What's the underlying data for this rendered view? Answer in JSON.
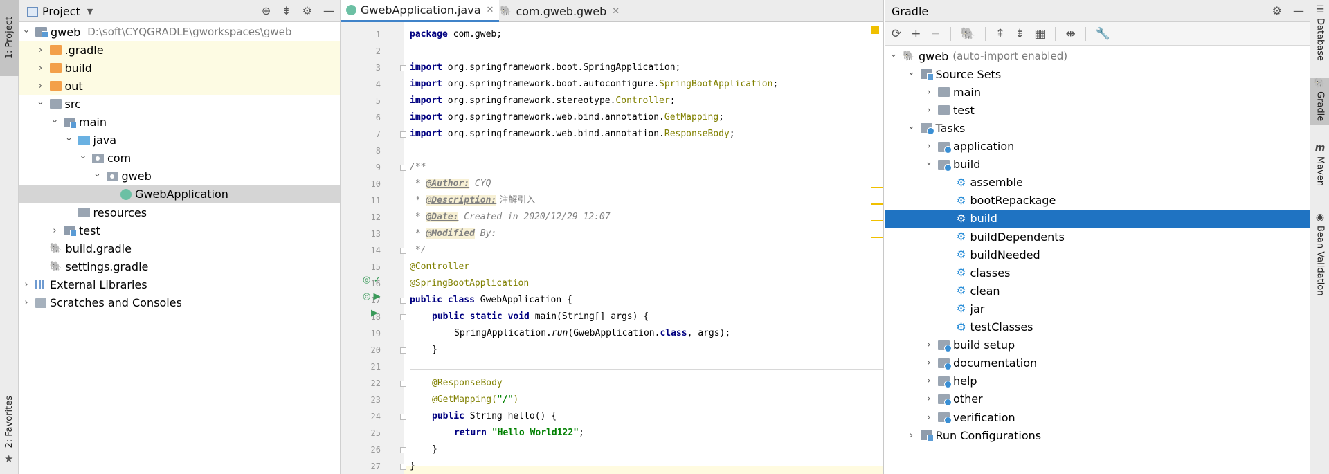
{
  "left_strip": {
    "project_tab": "1: Project",
    "favorites_tab": "2: Favorites"
  },
  "project": {
    "title": "Project",
    "tree": [
      {
        "label": "gweb",
        "path": "D:\\soft\\CYQGRADLE\\gworkspaces\\gweb",
        "icon": "folder-module",
        "depth": 0,
        "arrow": "down"
      },
      {
        "label": ".gradle",
        "icon": "folder-orange",
        "depth": 1,
        "arrow": "right",
        "highlight": "yellow"
      },
      {
        "label": "build",
        "icon": "folder-orange",
        "depth": 1,
        "arrow": "right",
        "highlight": "yellow"
      },
      {
        "label": "out",
        "icon": "folder-orange",
        "depth": 1,
        "arrow": "right",
        "highlight": "yellow"
      },
      {
        "label": "src",
        "icon": "folder-gray",
        "depth": 1,
        "arrow": "down"
      },
      {
        "label": "main",
        "icon": "folder-module",
        "depth": 2,
        "arrow": "down"
      },
      {
        "label": "java",
        "icon": "folder-blue",
        "depth": 3,
        "arrow": "down"
      },
      {
        "label": "com",
        "icon": "pkg",
        "depth": 4,
        "arrow": "down"
      },
      {
        "label": "gweb",
        "icon": "pkg",
        "depth": 5,
        "arrow": "down"
      },
      {
        "label": "GwebApplication",
        "icon": "spring",
        "depth": 6,
        "arrow": "",
        "highlight": "selected"
      },
      {
        "label": "resources",
        "icon": "folder-gray",
        "depth": 3,
        "arrow": ""
      },
      {
        "label": "test",
        "icon": "folder-module",
        "depth": 2,
        "arrow": "right"
      },
      {
        "label": "build.gradle",
        "icon": "elephant",
        "depth": 1,
        "arrow": ""
      },
      {
        "label": "settings.gradle",
        "icon": "elephant",
        "depth": 1,
        "arrow": ""
      },
      {
        "label": "External Libraries",
        "icon": "libs",
        "depth": 0,
        "arrow": "right"
      },
      {
        "label": "Scratches and Consoles",
        "icon": "scratch",
        "depth": 0,
        "arrow": "right"
      }
    ]
  },
  "editor": {
    "tabs": [
      {
        "label": "GwebApplication.java",
        "active": true
      },
      {
        "label": "com.gweb.gweb",
        "active": false
      }
    ],
    "lines": [
      "1",
      "2",
      "3",
      "4",
      "5",
      "6",
      "7",
      "8",
      "9",
      "10",
      "11",
      "12",
      "13",
      "14",
      "15",
      "16",
      "17",
      "18",
      "19",
      "20",
      "21",
      "22",
      "23",
      "24",
      "25",
      "26",
      "27"
    ],
    "code": {
      "l1_kw": "package",
      "l1_rest": " com.gweb;",
      "imp": "import",
      "l3": " org.springframework.boot.SpringApplication;",
      "l4a": " org.springframework.boot.autoconfigure.",
      "l4b": "SpringBootApplication",
      "l4c": ";",
      "l5a": " org.springframework.stereotype.",
      "l5b": "Controller",
      "l5c": ";",
      "l6a": " org.springframework.web.bind.annotation.",
      "l6b": "GetMapping",
      "l6c": ";",
      "l7a": " org.springframework.web.bind.annotation.",
      "l7b": "ResponseBody",
      "l7c": ";",
      "l9": "/**",
      "star": " * ",
      "l10_tag": "@Author:",
      "l10_val": " CYQ",
      "l11_tag": "@Description:",
      "l11_val": " 注解引入",
      "l12_tag": "@Date:",
      "l12_val": " Created in 2020/12/29 12:07",
      "l13_tag": "@Modified",
      "l13_val": " By:",
      "l14": " */",
      "l15": "@Controller",
      "l16": "@SpringBootApplication",
      "l17_kw": "public class",
      "l17_rest": " GwebApplication {",
      "l18_kw": "public static void",
      "l18_rest": " main(String[] args) {",
      "l19_a": "SpringApplication.",
      "l19_b": "run",
      "l19_c": "(GwebApplication.",
      "l19_d": "class",
      "l19_e": ", args);",
      "l20": "}",
      "l22": "@ResponseBody",
      "l23_a": "@GetMapping(",
      "l23_b": "\"/\"",
      "l23_c": ")",
      "l24_kw": "public",
      "l24_rest": " String hello() {",
      "l25_kw": "return",
      "l25_str": "\"Hello World122\"",
      "l25_rest": ";",
      "l26": "}",
      "l27": "}"
    }
  },
  "gradle": {
    "title": "Gradle",
    "tree": [
      {
        "label": "gweb",
        "suffix": "(auto-import enabled)",
        "icon": "elephant",
        "depth": 0,
        "arrow": "down"
      },
      {
        "label": "Source Sets",
        "icon": "folder-module",
        "depth": 1,
        "arrow": "down"
      },
      {
        "label": "main",
        "icon": "folder-gray",
        "depth": 2,
        "arrow": "right"
      },
      {
        "label": "test",
        "icon": "folder-gray",
        "depth": 2,
        "arrow": "right"
      },
      {
        "label": "Tasks",
        "icon": "taskfolder",
        "depth": 1,
        "arrow": "down"
      },
      {
        "label": "application",
        "icon": "taskfolder",
        "depth": 2,
        "arrow": "right"
      },
      {
        "label": "build",
        "icon": "taskfolder",
        "depth": 2,
        "arrow": "down"
      },
      {
        "label": "assemble",
        "icon": "gear",
        "depth": 3,
        "arrow": ""
      },
      {
        "label": "bootRepackage",
        "icon": "gear",
        "depth": 3,
        "arrow": ""
      },
      {
        "label": "build",
        "icon": "gear",
        "depth": 3,
        "arrow": "",
        "highlight": "blue"
      },
      {
        "label": "buildDependents",
        "icon": "gear",
        "depth": 3,
        "arrow": ""
      },
      {
        "label": "buildNeeded",
        "icon": "gear",
        "depth": 3,
        "arrow": ""
      },
      {
        "label": "classes",
        "icon": "gear",
        "depth": 3,
        "arrow": ""
      },
      {
        "label": "clean",
        "icon": "gear",
        "depth": 3,
        "arrow": ""
      },
      {
        "label": "jar",
        "icon": "gear",
        "depth": 3,
        "arrow": ""
      },
      {
        "label": "testClasses",
        "icon": "gear",
        "depth": 3,
        "arrow": ""
      },
      {
        "label": "build setup",
        "icon": "taskfolder",
        "depth": 2,
        "arrow": "right"
      },
      {
        "label": "documentation",
        "icon": "taskfolder",
        "depth": 2,
        "arrow": "right"
      },
      {
        "label": "help",
        "icon": "taskfolder",
        "depth": 2,
        "arrow": "right"
      },
      {
        "label": "other",
        "icon": "taskfolder",
        "depth": 2,
        "arrow": "right"
      },
      {
        "label": "verification",
        "icon": "taskfolder",
        "depth": 2,
        "arrow": "right"
      },
      {
        "label": "Run Configurations",
        "icon": "folder-module",
        "depth": 1,
        "arrow": "right"
      }
    ]
  },
  "right_strip": {
    "database": "Database",
    "gradle": "Gradle",
    "maven": "Maven",
    "bean": "Bean Validation"
  }
}
